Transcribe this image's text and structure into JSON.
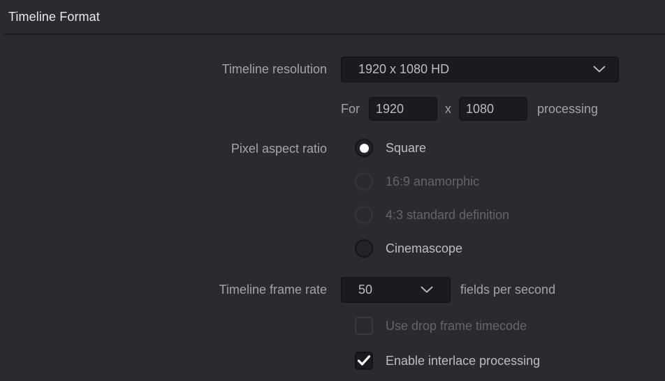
{
  "header": {
    "title": "Timeline Format"
  },
  "form": {
    "timeline_resolution": {
      "label": "Timeline resolution",
      "selected": "1920 x 1080 HD",
      "chevron_icon": "chevron-down-icon"
    },
    "processing_size": {
      "prefix": "For",
      "width": "1920",
      "separator": "x",
      "height": "1080",
      "suffix": "processing"
    },
    "pixel_aspect_ratio": {
      "label": "Pixel aspect ratio",
      "options": [
        {
          "label": "Square",
          "selected": true,
          "disabled": false
        },
        {
          "label": "16:9 anamorphic",
          "selected": false,
          "disabled": true
        },
        {
          "label": "4:3 standard definition",
          "selected": false,
          "disabled": true
        },
        {
          "label": "Cinemascope",
          "selected": false,
          "disabled": false
        }
      ]
    },
    "timeline_frame_rate": {
      "label": "Timeline frame rate",
      "selected": "50",
      "units": "fields per second",
      "chevron_icon": "chevron-down-icon"
    },
    "checkboxes": [
      {
        "label": "Use drop frame timecode",
        "checked": false,
        "disabled": true
      },
      {
        "label": "Enable interlace processing",
        "checked": true,
        "disabled": false
      }
    ]
  },
  "colors": {
    "panel_bg": "#2a2b31",
    "header_text": "#e9e9ec",
    "label_text": "#a3a4a9",
    "value_text": "#bcbdc1",
    "disabled_text": "#64656b",
    "field_bg": "#1a1b1f",
    "divider": "#1b1c21"
  }
}
